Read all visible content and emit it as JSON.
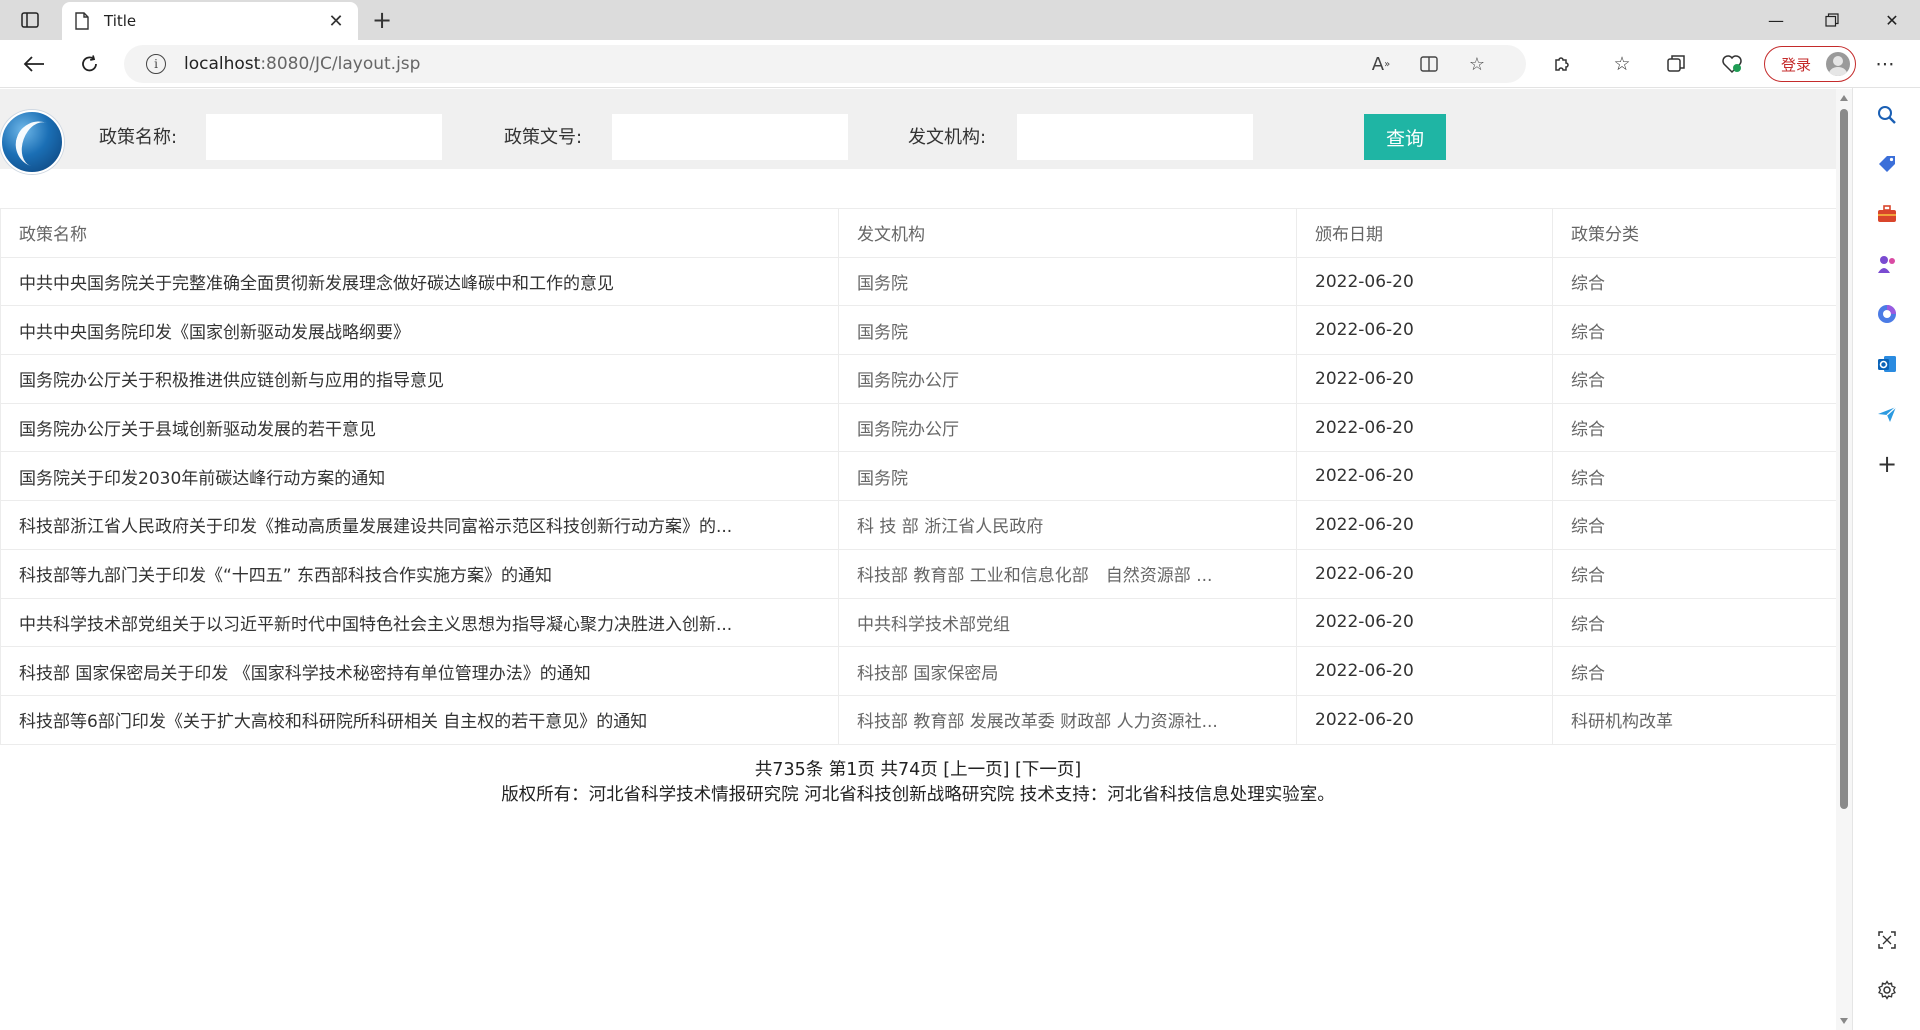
{
  "browser": {
    "tab_title": "Title",
    "url_host": "localhost",
    "url_path": ":8080/JC/layout.jsp",
    "login_label": "登录"
  },
  "search": {
    "policy_name_label": "政策名称:",
    "policy_number_label": "政策文号:",
    "issuer_label": "发文机构:",
    "query_label": "查询",
    "policy_name_value": "",
    "policy_number_value": "",
    "issuer_value": ""
  },
  "table": {
    "headers": [
      "政策名称",
      "发文机构",
      "颁布日期",
      "政策分类"
    ],
    "rows": [
      {
        "name": "中共中央国务院关于完整准确全面贯彻新发展理念做好碳达峰碳中和工作的意见",
        "issuer": "国务院",
        "date": "2022-06-20",
        "category": "综合"
      },
      {
        "name": "中共中央国务院印发《国家创新驱动发展战略纲要》",
        "issuer": "国务院",
        "date": "2022-06-20",
        "category": "综合"
      },
      {
        "name": "国务院办公厅关于积极推进供应链创新与应用的指导意见",
        "issuer": "国务院办公厅",
        "date": "2022-06-20",
        "category": "综合"
      },
      {
        "name": "国务院办公厅关于县域创新驱动发展的若干意见",
        "issuer": "国务院办公厅",
        "date": "2022-06-20",
        "category": "综合"
      },
      {
        "name": "国务院关于印发2030年前碳达峰行动方案的通知",
        "issuer": "国务院",
        "date": "2022-06-20",
        "category": "综合"
      },
      {
        "name": "科技部浙江省人民政府关于印发《推动高质量发展建设共同富裕示范区科技创新行动方案》的...",
        "issuer": "科 技 部 浙江省人民政府",
        "date": "2022-06-20",
        "category": "综合"
      },
      {
        "name": "科技部等九部门关于印发《“十四五” 东西部科技合作实施方案》的通知",
        "issuer": "科技部 教育部 工业和信息化部　自然资源部 ...",
        "date": "2022-06-20",
        "category": "综合"
      },
      {
        "name": "中共科学技术部党组关于以习近平新时代中国特色社会主义思想为指导凝心聚力决胜进入创新...",
        "issuer": "中共科学技术部党组",
        "date": "2022-06-20",
        "category": "综合"
      },
      {
        "name": "科技部 国家保密局关于印发 《国家科学技术秘密持有单位管理办法》的通知",
        "issuer": "科技部 国家保密局",
        "date": "2022-06-20",
        "category": "综合"
      },
      {
        "name": "科技部等6部门印发《关于扩大高校和科研院所科研相关 自主权的若干意见》的通知",
        "issuer": "科技部 教育部 发展改革委 财政部 人力资源社...",
        "date": "2022-06-20",
        "category": "科研机构改革"
      }
    ]
  },
  "pager": {
    "text": "共735条 第1页 共74页 [上一页] [下一页]"
  },
  "footer": {
    "text": "版权所有：河北省科学技术情报研究院 河北省科技创新战略研究院 技术支持：河北省科技信息处理实验室。"
  }
}
